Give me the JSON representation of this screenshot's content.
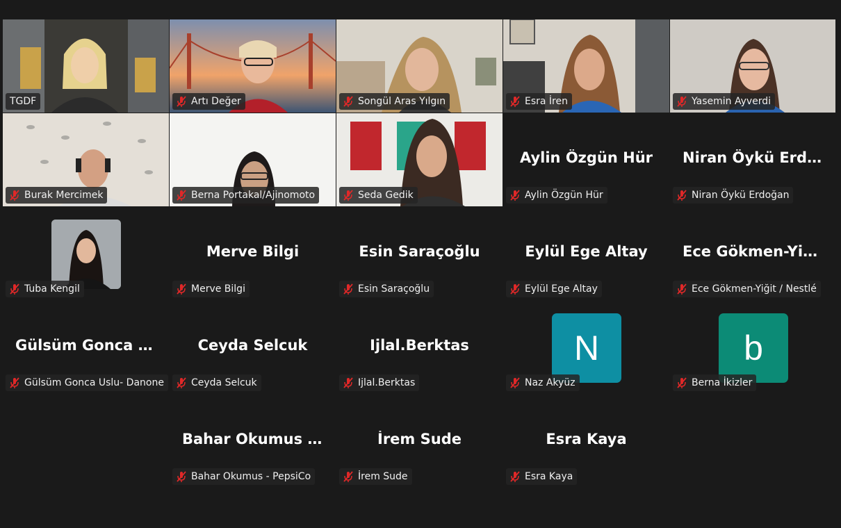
{
  "colors": {
    "background": "#1a1a1a",
    "active_border": "#23d959",
    "mute_red": "#e02828",
    "avatar_n": "#0e8fa3",
    "avatar_b": "#0c8b76"
  },
  "participants": [
    {
      "display": "TGDF",
      "muted": false,
      "active": true,
      "kind": "video",
      "scene": "office"
    },
    {
      "display": "Artı Değer",
      "muted": true,
      "kind": "video",
      "scene": "bridge"
    },
    {
      "display": "Songül Aras Yılgın",
      "muted": true,
      "kind": "video",
      "scene": "room"
    },
    {
      "display": "Esra İren",
      "muted": true,
      "kind": "video",
      "scene": "room2"
    },
    {
      "display": "Yasemin Ayverdi",
      "muted": true,
      "kind": "video",
      "scene": "wall"
    },
    {
      "display": "Burak Mercimek",
      "muted": true,
      "kind": "video",
      "scene": "pattern"
    },
    {
      "display": "Berna Portakal/Ajinomoto",
      "muted": true,
      "kind": "video",
      "scene": "white"
    },
    {
      "display": "Seda Gedik",
      "muted": true,
      "kind": "video",
      "scene": "posters"
    },
    {
      "display": "Aylin Özgün Hür",
      "big": "Aylin Özgün Hür",
      "muted": true,
      "kind": "name"
    },
    {
      "display": "Niran Öykü Erdoğan",
      "big": "Niran Öykü Erdoğan",
      "muted": true,
      "kind": "name"
    },
    {
      "display": "Tuba Kengil",
      "muted": true,
      "kind": "photo"
    },
    {
      "display": "Merve Bilgi",
      "big": "Merve Bilgi",
      "muted": true,
      "kind": "name"
    },
    {
      "display": "Esin Saraçoğlu",
      "big": "Esin Saraçoğlu",
      "muted": true,
      "kind": "name"
    },
    {
      "display": "Eylül Ege Altay",
      "big": "Eylül Ege Altay",
      "muted": true,
      "kind": "name"
    },
    {
      "display": "Ece Gökmen-Yiğit / Nestlé",
      "big": "Ece Gökmen-Yiğit / Nestlé",
      "muted": true,
      "kind": "name"
    },
    {
      "display": "Gülsüm Gonca Uslu- Danone",
      "big": "Gülsüm Gonca Uslu- Danone",
      "muted": true,
      "kind": "name"
    },
    {
      "display": "Ceyda Selcuk",
      "big": "Ceyda Selcuk",
      "muted": true,
      "kind": "name"
    },
    {
      "display": "Ijlal.Berktas",
      "big": "Ijlal.Berktas",
      "muted": true,
      "kind": "name"
    },
    {
      "display": "Naz Akyüz",
      "letter": "N",
      "muted": true,
      "kind": "letter",
      "color": "#0e8fa3"
    },
    {
      "display": "Berna İkizler",
      "letter": "b",
      "muted": true,
      "kind": "letter",
      "color": "#0c8b76"
    },
    {
      "display": "Bahar Okumus - PepsiCo",
      "big": "Bahar Okumus - PepsiCo",
      "muted": true,
      "kind": "name"
    },
    {
      "display": "İrem Sude",
      "big": "İrem Sude",
      "muted": true,
      "kind": "name"
    },
    {
      "display": "Esra Kaya",
      "big": "Esra Kaya",
      "muted": true,
      "kind": "name"
    }
  ]
}
